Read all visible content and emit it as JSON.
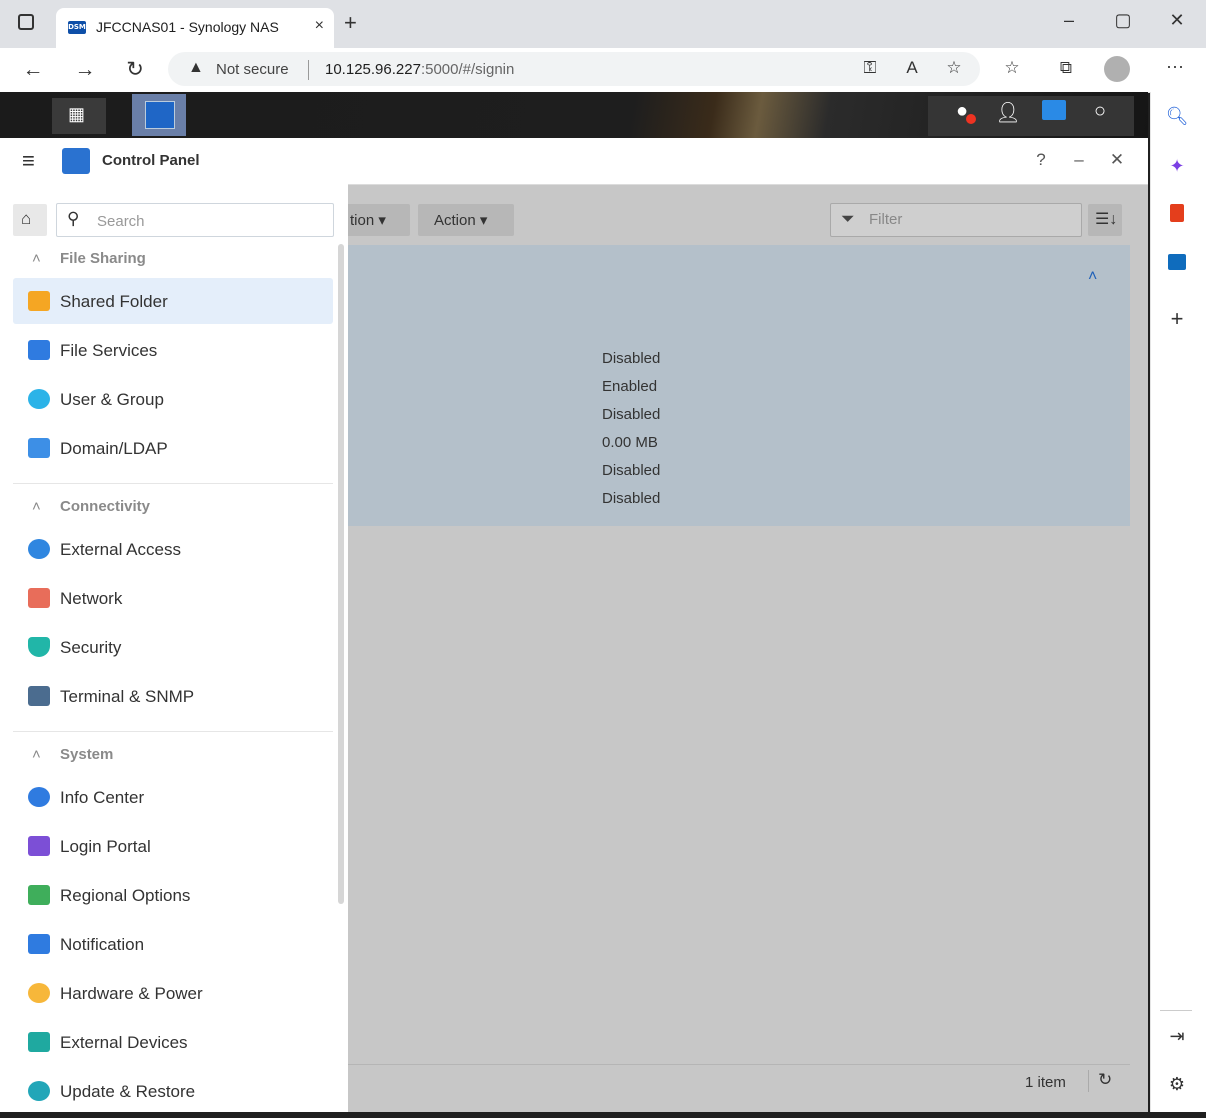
{
  "browser": {
    "tab_title": "JFCCNAS01 - Synology NAS",
    "tab_favicon_text": "DSM",
    "tab_close": "×",
    "new_tab": "+",
    "security_label": "Not secure",
    "url_host": "10.125.96.227",
    "url_rest": ":5000/#/signin",
    "window_controls": [
      "–",
      "▢",
      "✕"
    ]
  },
  "control_panel": {
    "title": "Control Panel",
    "help": "?",
    "minimize": "–",
    "close": "✕"
  },
  "toolbar": {
    "button1_label": "tion ▾",
    "action_label": "Action ▾",
    "filter_placeholder": "Filter"
  },
  "detail_values": [
    "Disabled",
    "Enabled",
    "Disabled",
    "0.00 MB",
    "Disabled",
    "Disabled"
  ],
  "footer": {
    "item_count": "1 item"
  },
  "sidebar": {
    "search_placeholder": "Search",
    "sections": [
      {
        "title": "File Sharing",
        "items": [
          "Shared Folder",
          "File Services",
          "User & Group",
          "Domain/LDAP"
        ]
      },
      {
        "title": "Connectivity",
        "items": [
          "External Access",
          "Network",
          "Security",
          "Terminal & SNMP"
        ]
      },
      {
        "title": "System",
        "items": [
          "Info Center",
          "Login Portal",
          "Regional Options",
          "Notification",
          "Hardware & Power",
          "External Devices",
          "Update & Restore"
        ]
      }
    ],
    "selected_item": "Shared Folder"
  },
  "colors": {
    "selected_bg": "#e4eefa",
    "detail_panel_bg": "#b4c0ca",
    "accent_blue": "#1f60b8"
  }
}
